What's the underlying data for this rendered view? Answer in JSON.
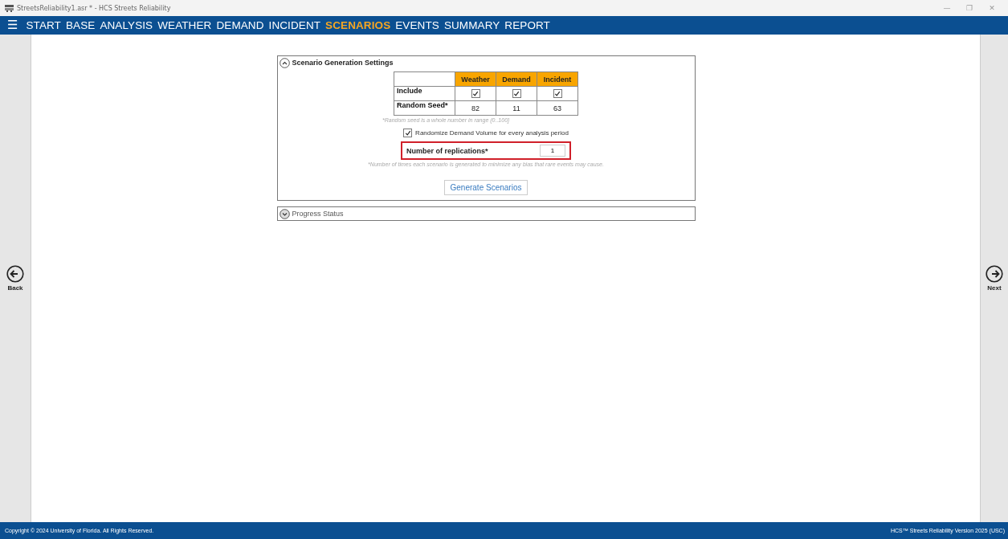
{
  "window": {
    "title": "StreetsReliability1.asr * - HCS Streets Reliability",
    "controls": [
      "—",
      "❐",
      "✕"
    ]
  },
  "menu": {
    "icon": "☰",
    "items": [
      {
        "label": "START",
        "selected": false
      },
      {
        "label": "BASE",
        "selected": false
      },
      {
        "label": "ANALYSIS",
        "selected": false
      },
      {
        "label": "WEATHER",
        "selected": false
      },
      {
        "label": "DEMAND",
        "selected": false
      },
      {
        "label": "INCIDENT",
        "selected": false
      },
      {
        "label": "SCENARIOS",
        "selected": true
      },
      {
        "label": "EVENTS",
        "selected": false
      },
      {
        "label": "SUMMARY",
        "selected": false
      },
      {
        "label": "REPORT",
        "selected": false
      }
    ]
  },
  "nav": {
    "back": "Back",
    "next": "Next"
  },
  "settings_panel": {
    "title": "Scenario Generation Settings",
    "expanded": true,
    "table": {
      "columns": [
        "Weather",
        "Demand",
        "Incident"
      ],
      "rows": [
        {
          "kind": "checkbox",
          "label": "Include",
          "cells": [
            {
              "checked": true
            },
            {
              "checked": true
            },
            {
              "checked": true
            }
          ]
        },
        {
          "kind": "text",
          "label": "Random Seed*",
          "cells": [
            {
              "value": "82"
            },
            {
              "value": "11"
            },
            {
              "value": "63"
            }
          ]
        }
      ]
    },
    "seed_note": "*Random seed is a whole number in range (0..100]",
    "randomize": {
      "label": "Randomize Demand Volume for every analysis period",
      "checked": true
    },
    "replications": {
      "label": "Number of replications*",
      "value": "1",
      "highlighted": true
    },
    "replications_note": "*Number of times each scenario is generated to minimize any bias that rare events may cause.",
    "button": "Generate Scenarios"
  },
  "progress_panel": {
    "title": "Progress Status",
    "expanded": false
  },
  "status_bar": {
    "left": "Copyright © 2024 University of Florida. All Rights Reserved.",
    "right": "HCS™ Streets Reliability Version 2025 (USC)"
  }
}
